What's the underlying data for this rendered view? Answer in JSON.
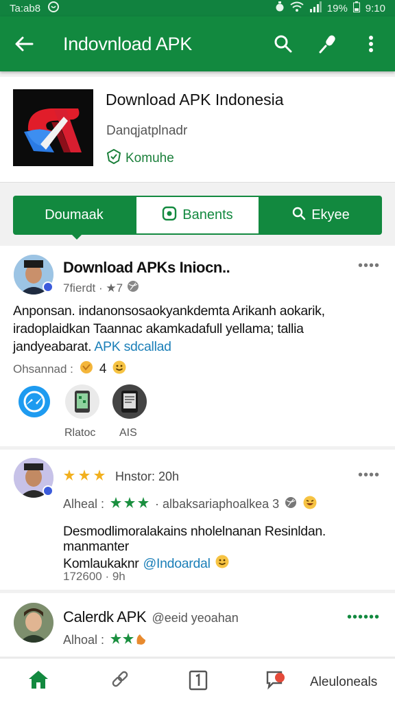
{
  "status_bar": {
    "time_left": "Ta:ab8",
    "battery": "19%",
    "time_right": "9:10"
  },
  "app_bar": {
    "title": "Indovnload APK"
  },
  "app": {
    "name": "Download APK Indonesia",
    "developer": "Danqjatplnadr",
    "verified_label": "Komuhe"
  },
  "tabs": [
    {
      "label": "Doumaak"
    },
    {
      "label": "Banents"
    },
    {
      "label": "Ekyee"
    }
  ],
  "posts": [
    {
      "author": "Download APKs Iniocn..",
      "meta": "7fierdt · ★7",
      "body_line1": "Anponsan. indanonsosaokyankdemta Arikanh aokarik,",
      "body_line2": "iradoplaidkan Taannac akamkadafull yellama; tallia",
      "body_line3_text": "jandyeabarat.",
      "body_line3_link": "APK sdcallad",
      "reactions_label": "Ohsannad :",
      "reactions_count": "4",
      "share_labels": [
        "",
        "Rlatoc",
        "AIS"
      ],
      "more": "••••"
    },
    {
      "rating_meta": "Hnstor: 20h",
      "line2_label": "Alheal :",
      "line2_text": "· albaksariaphoalkea 3",
      "body_line1": "Desmodlimoralakains nholelnanan Resinldan.",
      "body_line2": "manmanter",
      "body_line3_text": "Komlaukaknr",
      "body_line3_link": "@Indoardal",
      "footer": "172600 · 9h",
      "more": "••••"
    },
    {
      "author": "Calerdk APK",
      "author_handle": "@eeid yeoahan",
      "line2_label": "Alhoal :",
      "more": "••••••"
    }
  ],
  "bottom_nav": {
    "last_label": "Aleuloneals"
  },
  "colors": {
    "primary": "#12893f",
    "link": "#1b7fb8"
  }
}
